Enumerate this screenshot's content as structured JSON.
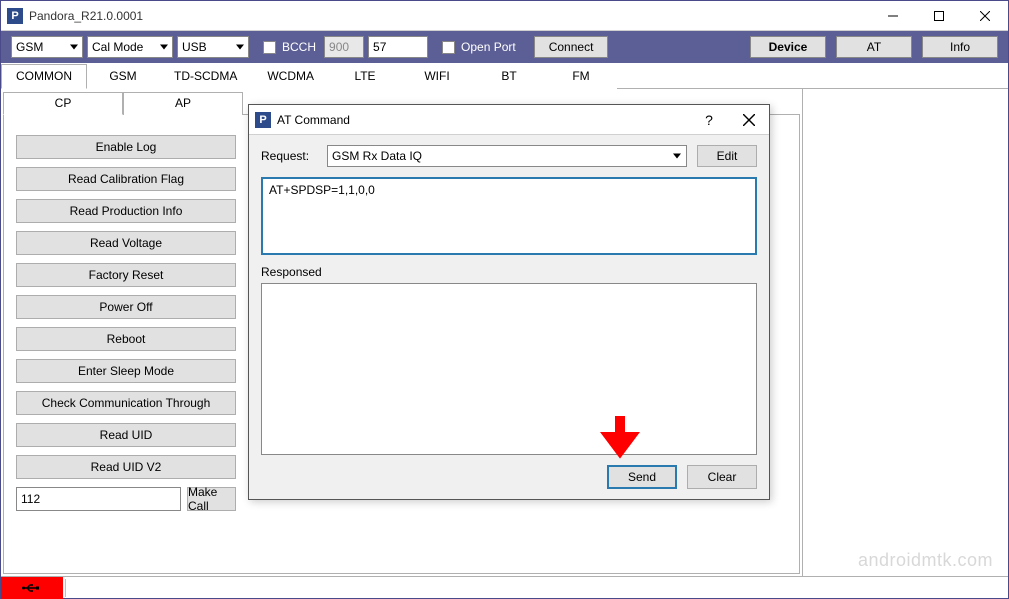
{
  "window": {
    "title": "Pandora_R21.0.0001"
  },
  "toolbar": {
    "mode1": "GSM",
    "mode2": "Cal Mode",
    "conn": "USB",
    "bcch_label": "BCCH",
    "bcch_val": "900",
    "chan": "57",
    "openport_label": "Open Port",
    "connect": "Connect",
    "device": "Device",
    "at": "AT",
    "info": "Info"
  },
  "tabs": {
    "common": "COMMON",
    "gsm": "GSM",
    "tdscdma": "TD-SCDMA",
    "wcdma": "WCDMA",
    "lte": "LTE",
    "wifi": "WIFI",
    "bt": "BT",
    "fm": "FM"
  },
  "subtabs": {
    "cp": "CP",
    "ap": "AP"
  },
  "buttons": {
    "enable_log": "Enable Log",
    "read_cal": "Read Calibration Flag",
    "read_prod": "Read Production Info",
    "read_volt": "Read Voltage",
    "factory_reset": "Factory Reset",
    "power_off": "Power Off",
    "reboot": "Reboot",
    "enter_sleep": "Enter Sleep Mode",
    "check_comm": "Check Communication Through",
    "read_uid": "Read UID",
    "read_uid_v2": "Read UID V2",
    "call_input": "112",
    "make_call": "Make Call"
  },
  "dialog": {
    "title": "AT Command",
    "request_label": "Request:",
    "request_sel": "GSM Rx Data IQ",
    "edit": "Edit",
    "cmd": "AT+SPDSP=1,1,0,0",
    "response_label": "Responsed",
    "response": "",
    "send": "Send",
    "clear": "Clear"
  },
  "watermark": "androidmtk.com"
}
